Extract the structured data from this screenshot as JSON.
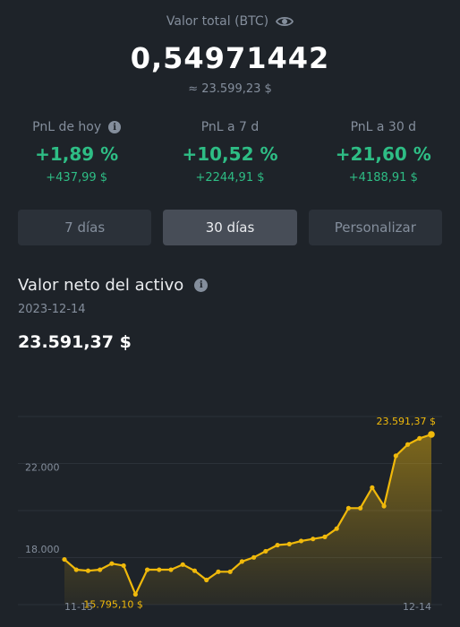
{
  "header": {
    "total_label": "Valor total (BTC)",
    "total_value": "0,54971442",
    "total_fiat": "≈ 23.599,23 $"
  },
  "pnl": [
    {
      "label": "PnL de hoy",
      "has_info": true,
      "pct": "+1,89 %",
      "abs": "+437,99 $"
    },
    {
      "label": "PnL a 7 d",
      "has_info": false,
      "pct": "+10,52 %",
      "abs": "+2244,91 $"
    },
    {
      "label": "PnL a 30 d",
      "has_info": false,
      "pct": "+21,60 %",
      "abs": "+4188,91 $"
    }
  ],
  "range_buttons": [
    {
      "label": "7 días",
      "active": false
    },
    {
      "label": "30 días",
      "active": true
    },
    {
      "label": "Personalizar",
      "active": false
    }
  ],
  "net_value": {
    "title": "Valor neto del activo",
    "date": "2023-12-14",
    "value": "23.591,37 $"
  },
  "colors": {
    "positive": "#2ebd85",
    "accent": "#f0b90b",
    "muted": "#848e9c",
    "bg": "#1e2329"
  },
  "chart_data": {
    "type": "area",
    "x_start_label": "11-15",
    "x_end_label": "12-14",
    "y_ticks": [
      {
        "value": 22000,
        "label": "22.000"
      },
      {
        "value": 18000,
        "label": "18.000"
      }
    ],
    "ylim": [
      15300,
      24900
    ],
    "grid": true,
    "max_label": "23.591,37 $",
    "min_label": "15.795,10 $",
    "values": [
      17500,
      17000,
      16950,
      17000,
      17300,
      17200,
      15800,
      17000,
      17000,
      17000,
      17250,
      16950,
      16500,
      16900,
      16900,
      17400,
      17600,
      17900,
      18200,
      18250,
      18400,
      18500,
      18600,
      19000,
      20000,
      20000,
      21000,
      20100,
      22550,
      23100,
      23400,
      23591
    ]
  }
}
